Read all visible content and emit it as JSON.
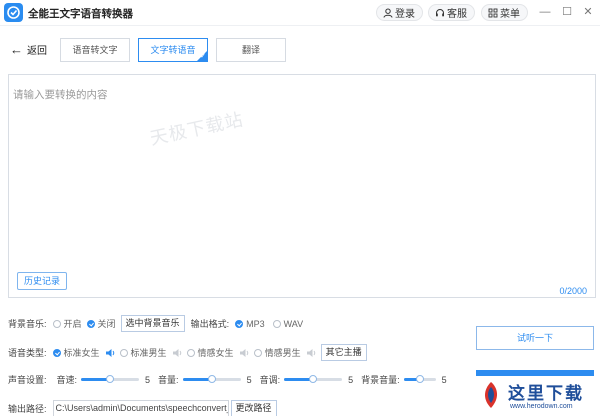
{
  "app": {
    "title": "全能王文字语音转换器"
  },
  "titlebar": {
    "login": "登录",
    "service": "客服",
    "menu": "菜单",
    "minimize": "—",
    "maximize": "☐",
    "close": "✕"
  },
  "nav": {
    "back": "返回"
  },
  "tabs": [
    {
      "label": "语音转文字",
      "active": false
    },
    {
      "label": "文字转语音",
      "active": true
    },
    {
      "label": "翻译",
      "active": false
    }
  ],
  "editor": {
    "placeholder": "请输入要转换的内容",
    "watermark": "天极下载站",
    "history": "历史记录",
    "counter": "0/2000"
  },
  "bg_music": {
    "label": "背景音乐:",
    "on": "开启",
    "off": "关闭",
    "select": "选中背景音乐",
    "selected": "关闭"
  },
  "output_format": {
    "label": "输出格式:",
    "options": [
      "MP3",
      "WAV"
    ],
    "selected": "MP3"
  },
  "voice_type": {
    "label": "语音类型:",
    "options": [
      "标准女生",
      "标准男生",
      "情感女生",
      "情感男生"
    ],
    "selected": "标准女生",
    "other": "其它主播"
  },
  "sound": {
    "label": "声音设置:",
    "speed": {
      "label": "音速:",
      "value": "5",
      "level": 0.5
    },
    "volume": {
      "label": "音量:",
      "value": "5",
      "level": 0.5
    },
    "pitch": {
      "label": "音调:",
      "value": "5",
      "level": 0.5
    },
    "bg_volume": {
      "label": "背景音量:",
      "value": "5",
      "level": 0.5
    }
  },
  "output_path": {
    "label": "输出路径:",
    "value": "C:\\Users\\admin\\Documents\\speechconvert_",
    "change": "更改路径"
  },
  "actions": {
    "listen": "试听一下"
  },
  "stamp": {
    "title": "这里下载",
    "url": "www.herodown.com"
  },
  "colors": {
    "accent": "#2d8cf0",
    "brand": "#2a8cf0"
  }
}
